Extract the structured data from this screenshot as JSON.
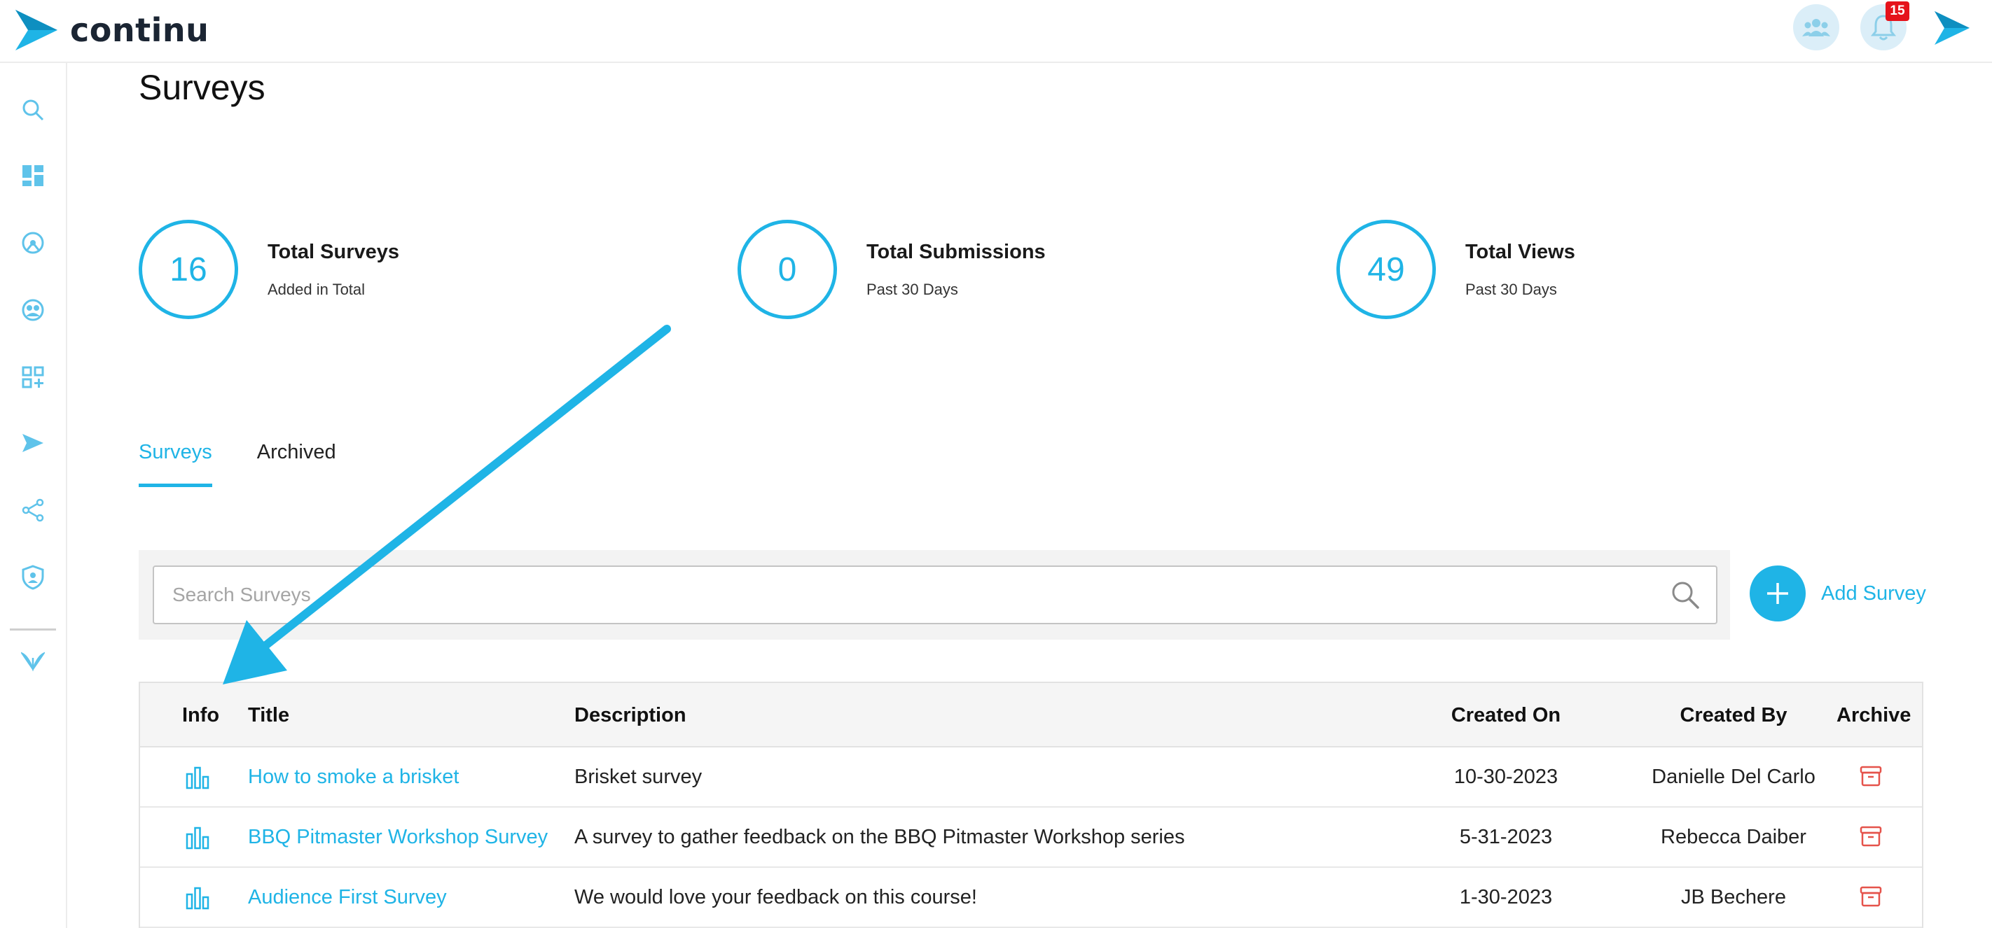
{
  "app": {
    "logo_text": "continu"
  },
  "header": {
    "notifications_count": "15"
  },
  "page": {
    "title": "Surveys"
  },
  "stats": [
    {
      "value": "16",
      "label": "Total Surveys",
      "sub": "Added in Total"
    },
    {
      "value": "0",
      "label": "Total Submissions",
      "sub": "Past 30 Days"
    },
    {
      "value": "49",
      "label": "Total Views",
      "sub": "Past 30 Days"
    }
  ],
  "tabs": [
    {
      "label": "Surveys",
      "active": true
    },
    {
      "label": "Archived",
      "active": false
    }
  ],
  "search": {
    "placeholder": "Search Surveys",
    "value": ""
  },
  "add_survey": {
    "label": "Add Survey"
  },
  "table": {
    "headers": {
      "info": "Info",
      "title": "Title",
      "description": "Description",
      "created_on": "Created On",
      "created_by": "Created By",
      "archive": "Archive"
    },
    "rows": [
      {
        "title": "How to smoke a brisket",
        "description": "Brisket survey",
        "created_on": "10-30-2023",
        "created_by": "Danielle Del Carlo"
      },
      {
        "title": "BBQ Pitmaster Workshop Survey",
        "description": "A survey to gather feedback on the BBQ Pitmaster Workshop series",
        "created_on": "5-31-2023",
        "created_by": "Rebecca Daiber"
      },
      {
        "title": "Audience First Survey",
        "description": "We would love your feedback on this course!",
        "created_on": "1-30-2023",
        "created_by": "JB Bechere"
      }
    ]
  },
  "colors": {
    "accent": "#1fb4e6",
    "archive_red": "#e5534b",
    "badge_red": "#e5121b",
    "logo_dark": "#1b2533"
  },
  "icons": {
    "sidebar": [
      "search-icon",
      "dashboard-icon",
      "explore-icon",
      "groups-icon",
      "add-widget-icon",
      "send-icon",
      "share-icon",
      "shield-user-icon",
      "brand-leaf-icon"
    ],
    "header": [
      "team-icon",
      "bell-icon",
      "brand-arrow-icon"
    ],
    "table_row": [
      "bar-chart-icon",
      "archive-box-icon"
    ]
  }
}
